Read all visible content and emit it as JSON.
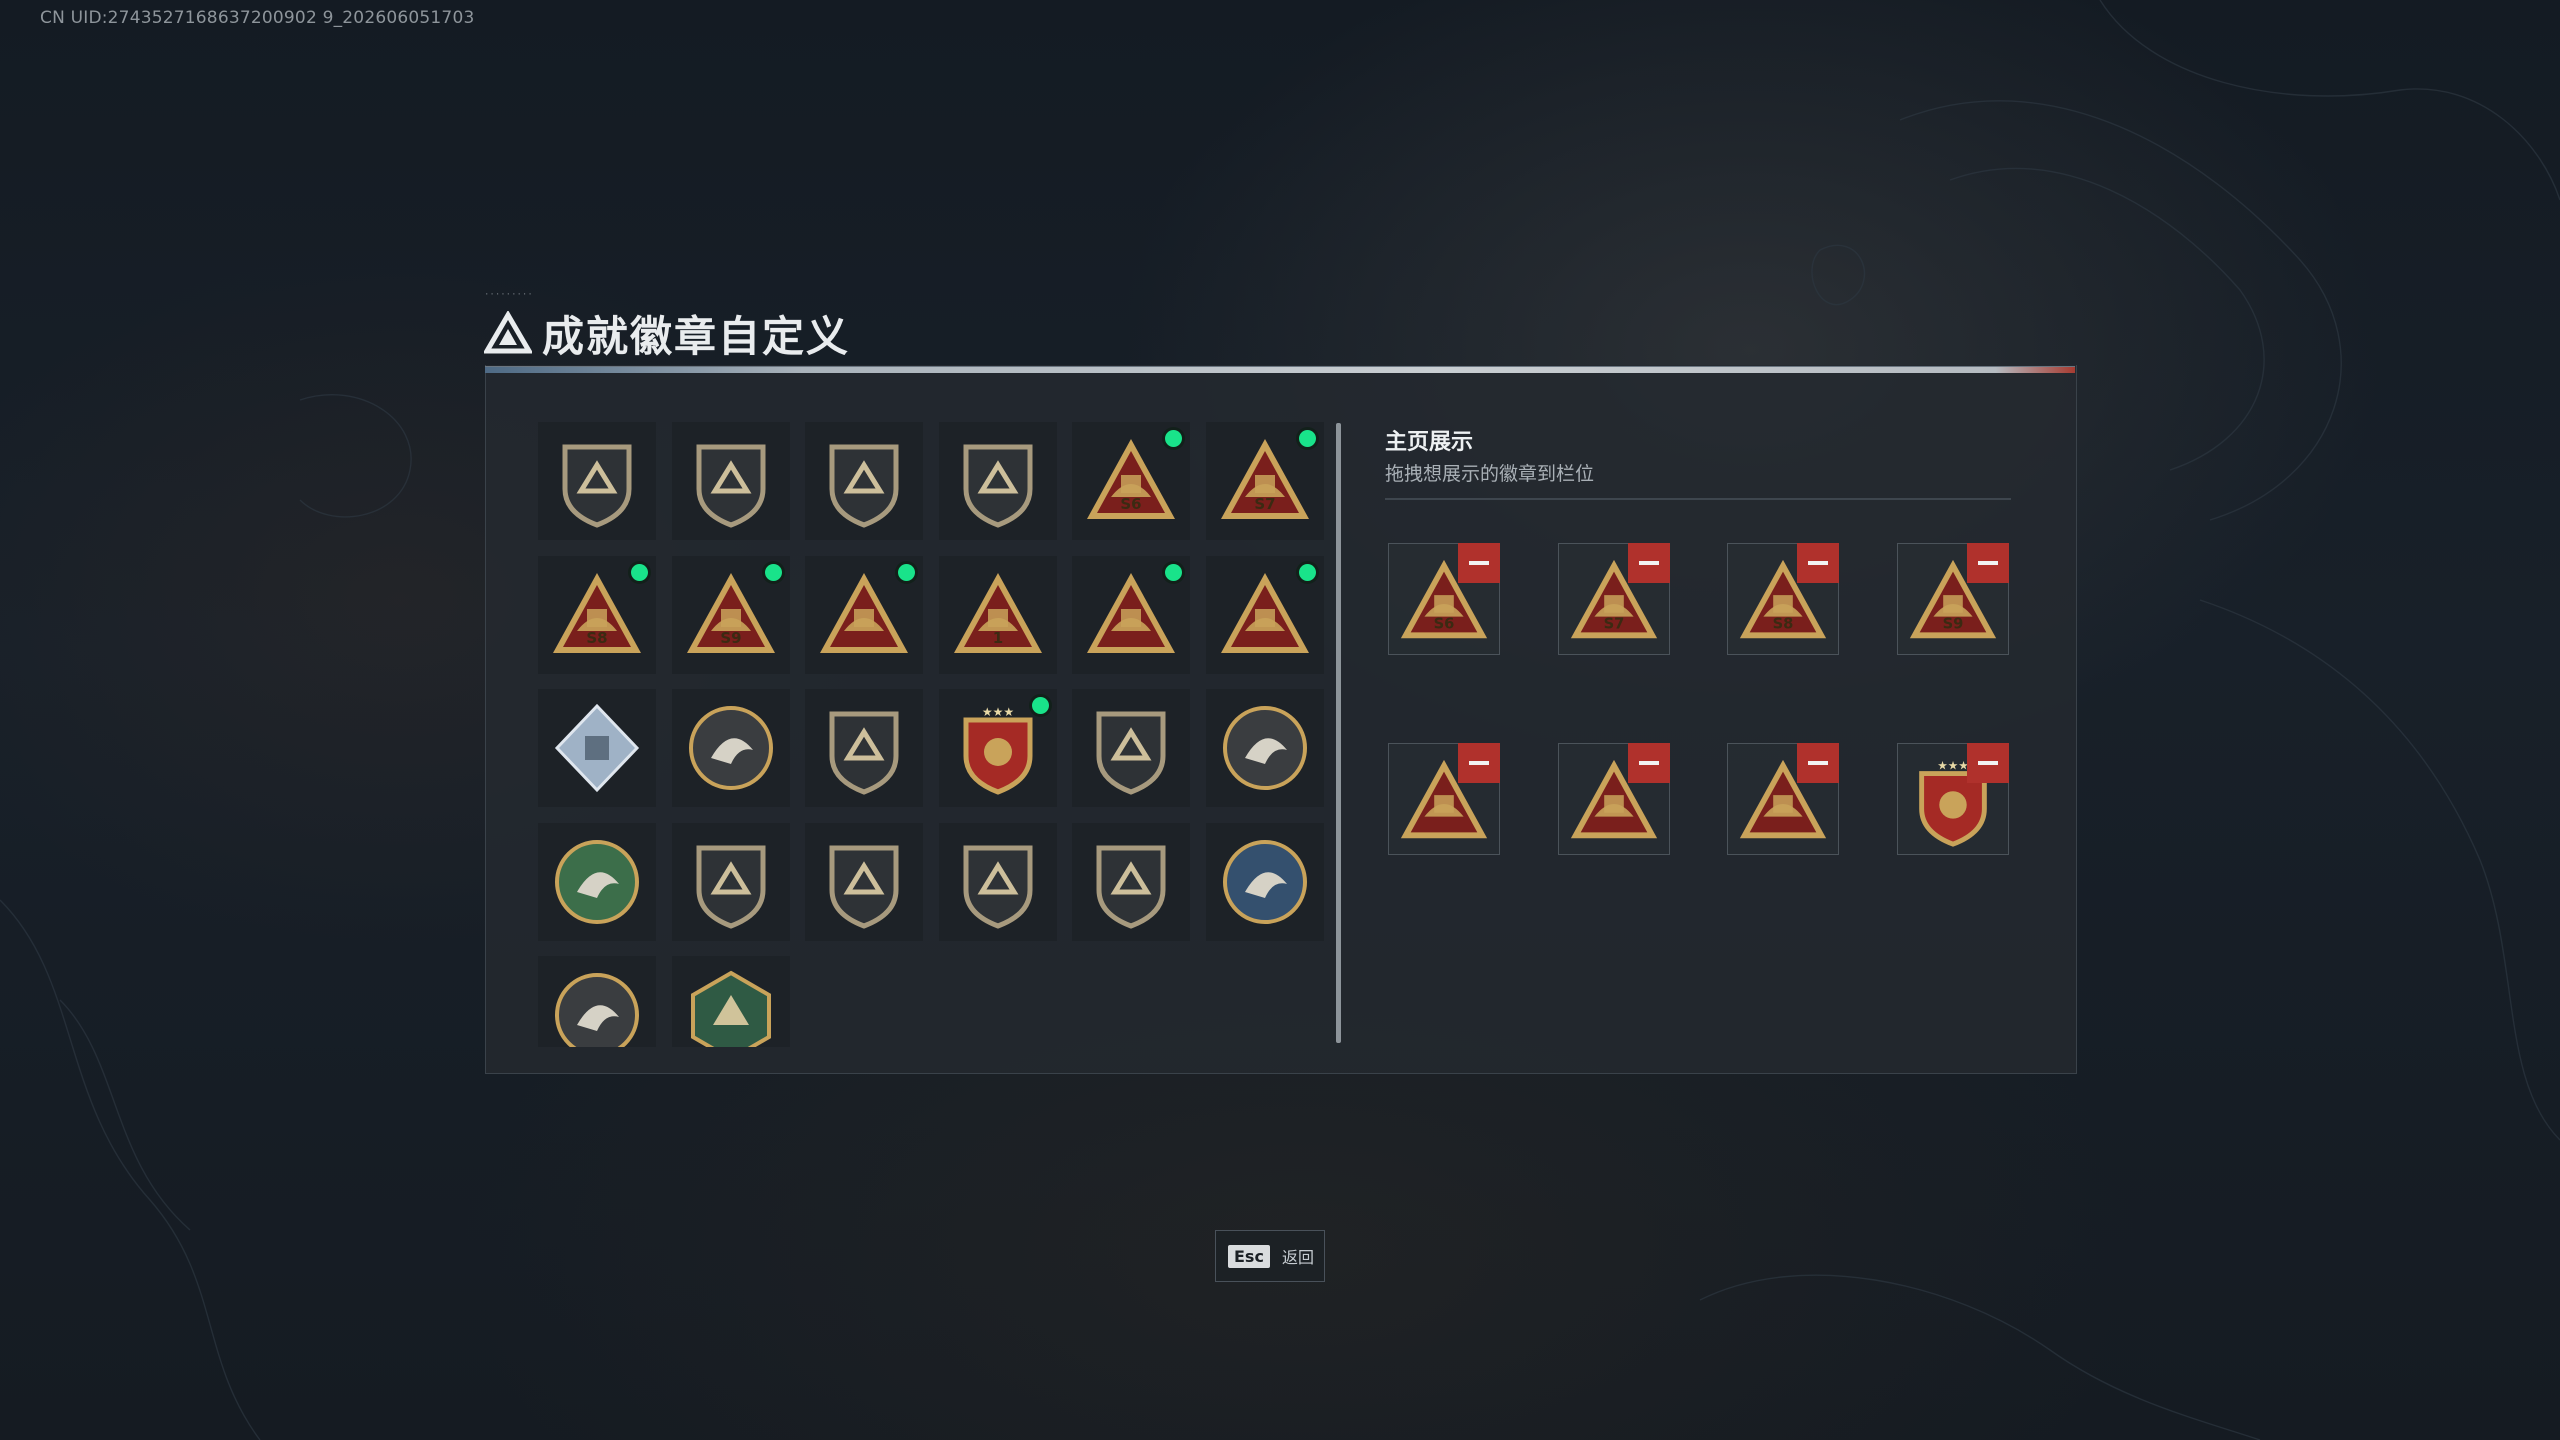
{
  "uid_text": "CN UID:2743527168637200902 9_202606051703",
  "title": "成就徽章自定义",
  "display": {
    "title": "主页展示",
    "subtitle": "拖拽想展示的徽章到栏位"
  },
  "badges": [
    {
      "icon": "triangle-logo-shield-icon",
      "new": false,
      "text": ""
    },
    {
      "icon": "helicopter-shield-icon",
      "new": false,
      "text": ""
    },
    {
      "icon": "diamond-emblem-shield-icon",
      "new": false,
      "text": ""
    },
    {
      "icon": "blade-shield-icon",
      "new": false,
      "text": ""
    },
    {
      "icon": "season-56-triangle-icon",
      "new": true,
      "text": "S6"
    },
    {
      "icon": "season-57-triangle-icon",
      "new": true,
      "text": "S7"
    },
    {
      "icon": "season-58-triangle-icon",
      "new": true,
      "text": "S8"
    },
    {
      "icon": "season-59-triangle-icon",
      "new": true,
      "text": "S9"
    },
    {
      "icon": "wings-triangle-icon",
      "new": true,
      "text": ""
    },
    {
      "icon": "rank-one-triangle-icon",
      "new": false,
      "text": "1"
    },
    {
      "icon": "operator-triangle-icon",
      "new": true,
      "text": ""
    },
    {
      "icon": "soldier-triangle-icon",
      "new": true,
      "text": ""
    },
    {
      "icon": "silver-diamond-icon",
      "new": false,
      "text": ""
    },
    {
      "icon": "star-medal-icon",
      "new": false,
      "text": ""
    },
    {
      "icon": "crest-shield-icon",
      "new": false,
      "text": ""
    },
    {
      "icon": "red-crest-icon",
      "new": true,
      "text": ""
    },
    {
      "icon": "skull-shield-icon",
      "new": false,
      "text": ""
    },
    {
      "icon": "masked-man-coin-icon",
      "new": false,
      "text": ""
    },
    {
      "icon": "green-clover-medal-icon",
      "new": false,
      "text": ""
    },
    {
      "icon": "blue-crosshair-shield-icon",
      "new": false,
      "text": ""
    },
    {
      "icon": "rifle-shield-icon",
      "new": false,
      "text": ""
    },
    {
      "icon": "sniper-shield-icon",
      "new": false,
      "text": ""
    },
    {
      "icon": "gold-crosshair-crest-icon",
      "new": false,
      "text": ""
    },
    {
      "icon": "blue-eagle-coin-icon",
      "new": false,
      "text": ""
    },
    {
      "icon": "eagle-coin-icon",
      "new": false,
      "text": ""
    },
    {
      "icon": "green-hornet-hexagon-icon",
      "new": false,
      "text": ""
    }
  ],
  "slots": [
    {
      "icon": "season-56-triangle-icon",
      "text": "S6"
    },
    {
      "icon": "season-57-triangle-icon",
      "text": "S7"
    },
    {
      "icon": "season-58-triangle-icon",
      "text": "S8"
    },
    {
      "icon": "season-59-triangle-icon",
      "text": "S9"
    },
    {
      "icon": "wings-triangle-icon",
      "text": ""
    },
    {
      "icon": "operator-triangle-icon",
      "text": ""
    },
    {
      "icon": "soldier-triangle-icon",
      "text": ""
    },
    {
      "icon": "red-crest-icon",
      "text": ""
    }
  ],
  "esc": {
    "key": "Esc",
    "label": "返回"
  },
  "colors": {
    "new_dot": "#19e38a",
    "remove": "#b0312c",
    "gold": "#c9a35a",
    "triangle_red": "#7a1f1c"
  }
}
